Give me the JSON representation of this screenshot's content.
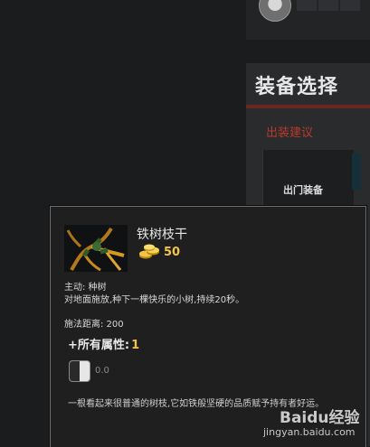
{
  "equip_panel": {
    "title": "装备选择",
    "subtitle": "出装建议",
    "recommend_label": "出门装备"
  },
  "tooltip": {
    "item_name": "铁树枝干",
    "cost": "50",
    "active_label": "主动: 种树",
    "active_desc": "对地面施放,种下一棵快乐的小树,持续20秒。",
    "cast_range": "施法距离: 200",
    "attr_label": "+所有属性:",
    "attr_value": "1",
    "cooldown": "0.0",
    "lore": "一根看起来很普通的树枝,它如铁般坚硬的品质赋予持有者好运。"
  },
  "colors": {
    "gold": "#f2c44a",
    "accent_red": "#b83a2c"
  },
  "icons": [
    "hero-portrait-icon",
    "iron-branch-icon",
    "gold-coin-icon",
    "cooldown-icon"
  ],
  "watermark": {
    "logo": "Baidu经验",
    "url": "jingyan.baidu.com"
  }
}
